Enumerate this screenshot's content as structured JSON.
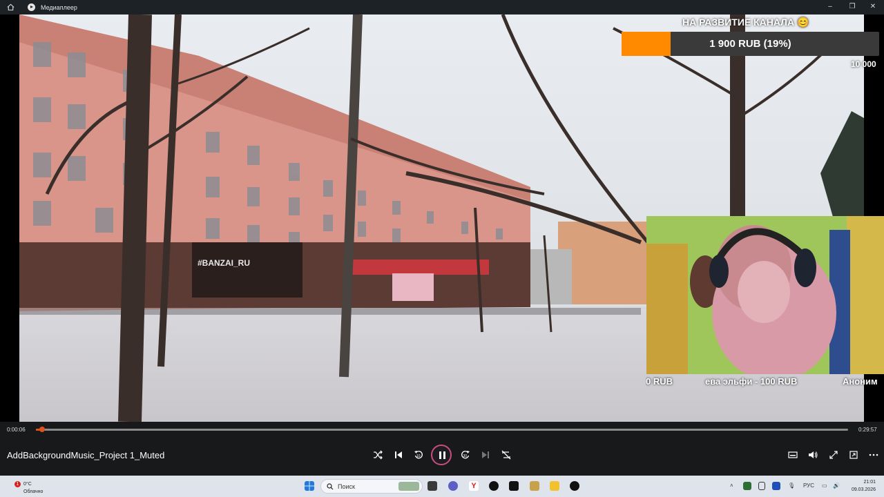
{
  "window": {
    "title": "Медиаплеер",
    "home_icon": "home-icon",
    "app_icon": "media-player-icon",
    "buttons": [
      "minimize-icon",
      "restore-icon",
      "close-icon"
    ]
  },
  "overlay": {
    "goal_title": "НА РАЗВИТИЕ КАНАЛА 😊",
    "goal_label": "1 900 RUB (19%)",
    "goal_progress": 0.19,
    "goal_target": "10 000",
    "colors": {
      "goal_fill": "#ff8a00",
      "goal_track": "#3a3a3a"
    }
  },
  "ticker": {
    "items": [
      "0 RUB",
      "ева эльфи - 100 RUB",
      "Аноним"
    ]
  },
  "video_scene": {
    "sign_text": "#BANZAI_RU"
  },
  "player": {
    "current_time": "0:00:06",
    "total_time": "0:29:57",
    "progress": 0.0035,
    "file_name": "AddBackgroundMusic_Project 1_Muted",
    "controls": [
      "shuffle-icon",
      "previous-icon",
      "rewind-10-icon",
      "pause-icon",
      "forward-30-icon",
      "next-icon",
      "repeat-off-icon"
    ],
    "right_controls": [
      "subtitles-icon",
      "volume-icon",
      "fullscreen-icon",
      "mini-player-icon",
      "more-icon"
    ],
    "accent": "#e0521d"
  },
  "taskbar": {
    "weather_badge": "1",
    "weather_temp": "0°C",
    "weather_cond": "Облачно",
    "search_placeholder": "Поиск",
    "language": "РУС",
    "time": "21:01",
    "date": "09.03.2026"
  }
}
